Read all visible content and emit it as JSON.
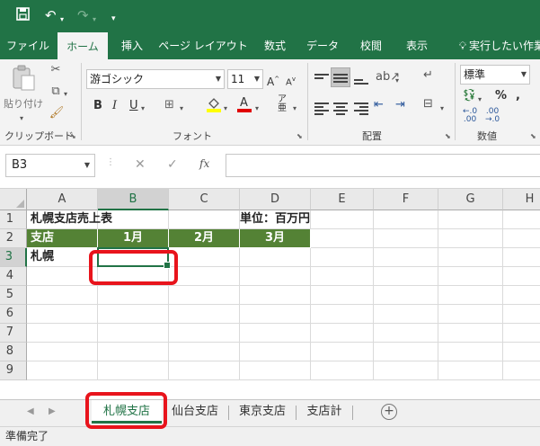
{
  "quick_access": {
    "save_icon": "save-icon",
    "undo_icon": "undo-icon",
    "redo_icon": "redo-icon",
    "customize_icon": "customize-icon"
  },
  "tabs": [
    {
      "label": "ファイル"
    },
    {
      "label": "ホーム"
    },
    {
      "label": "挿入"
    },
    {
      "label": "ページ レイアウト"
    },
    {
      "label": "数式"
    },
    {
      "label": "データ"
    },
    {
      "label": "校閲"
    },
    {
      "label": "表示"
    },
    {
      "label": "実行したい作業"
    }
  ],
  "ribbon": {
    "clipboard": {
      "paste_label": "貼り付け",
      "group_label": "クリップボード"
    },
    "font": {
      "font_name": "游ゴシック",
      "font_size": "11",
      "group_label": "フォント"
    },
    "alignment": {
      "group_label": "配置"
    },
    "number": {
      "format": "標準",
      "group_label": "数値"
    }
  },
  "formula_bar": {
    "name_box": "B3",
    "fx_label": "fx",
    "formula": ""
  },
  "grid": {
    "columns": [
      "A",
      "B",
      "C",
      "D",
      "E",
      "F",
      "G",
      "H"
    ],
    "rows": [
      "1",
      "2",
      "3",
      "4",
      "5",
      "6",
      "7",
      "8",
      "9"
    ],
    "active_cell": "B3",
    "cells": {
      "A1": "札幌支店売上表",
      "D1": "単位：百万円",
      "A2": "支店",
      "B2": "1月",
      "C2": "2月",
      "D2": "3月",
      "A3": "札幌"
    }
  },
  "sheets": [
    {
      "label": "札幌支店",
      "active": true
    },
    {
      "label": "仙台支店",
      "active": false
    },
    {
      "label": "東京支店",
      "active": false
    },
    {
      "label": "支店計",
      "active": false
    }
  ],
  "status": {
    "text": "準備完了"
  },
  "colors": {
    "excel_green": "#217346",
    "header_fill": "#548235",
    "highlight_red": "#e8141c"
  }
}
